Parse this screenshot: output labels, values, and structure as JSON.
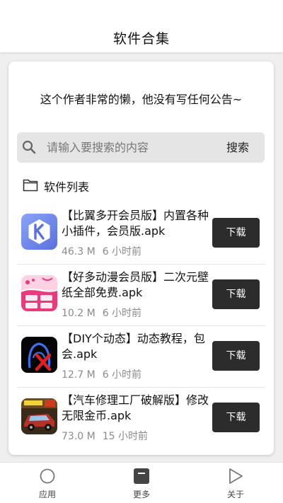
{
  "header": {
    "title": "软件合集"
  },
  "notice": {
    "text": "这个作者非常的懒，他没有写任何公告~"
  },
  "search": {
    "placeholder": "请输入要搜索的内容",
    "button_label": "搜索",
    "icon": "search-icon"
  },
  "section": {
    "title": "软件列表",
    "icon": "folder-icon"
  },
  "apps": [
    {
      "name": "【比翼多开会员版】内置各种小插件，会员版.apk",
      "size": "46.3 M",
      "time": "6 小时前",
      "button": "下载",
      "icon": "k-logo-icon"
    },
    {
      "name": "【好多动漫会员版】二次元壁纸全部免费.apk",
      "size": "10.2 M",
      "time": "6 小时前",
      "button": "下载",
      "icon": "haoduo-anime-icon"
    },
    {
      "name": "【DIY个动态】动态教程，包会.apk",
      "size": "12.7 M",
      "time": "6 小时前",
      "button": "下载",
      "icon": "diy-avatar-icon"
    },
    {
      "name": "【汽车修理工厂破解版】修改无限金币.apk",
      "size": "73.0 M",
      "time": "15 小时前",
      "button": "下载",
      "icon": "car-repair-icon"
    }
  ],
  "tabbar": [
    {
      "label": "应用",
      "icon": "circle-icon"
    },
    {
      "label": "更多",
      "icon": "box-icon"
    },
    {
      "label": "关于",
      "icon": "play-icon"
    }
  ],
  "colors": {
    "button_bg": "#2c2c2c",
    "search_bg": "#e5e5e5",
    "page_bg": "#efefef"
  }
}
